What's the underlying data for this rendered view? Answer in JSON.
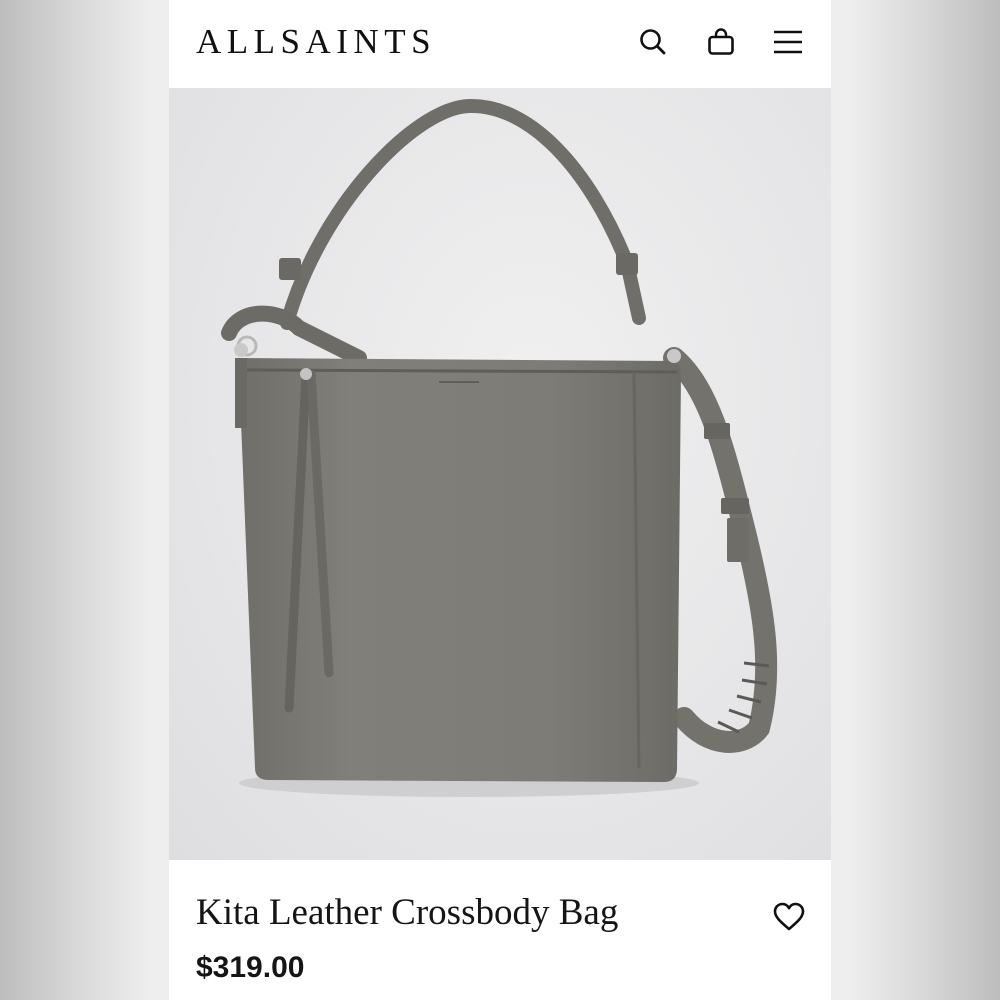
{
  "header": {
    "brand": "ALLSAINTS",
    "icons": [
      "search-icon",
      "shopping-bag-icon",
      "menu-icon"
    ]
  },
  "product": {
    "image_alt": "Grey leather crossbody bag with top handle and adjustable strap",
    "name": "Kita Leather Crossbody Bag",
    "price": "$319.00",
    "wishlist_icon": "heart-icon"
  },
  "colors": {
    "page_side": "#eeeeee",
    "panel": "#ffffff",
    "text": "#151515",
    "bag_leather": "#7b7a74"
  }
}
